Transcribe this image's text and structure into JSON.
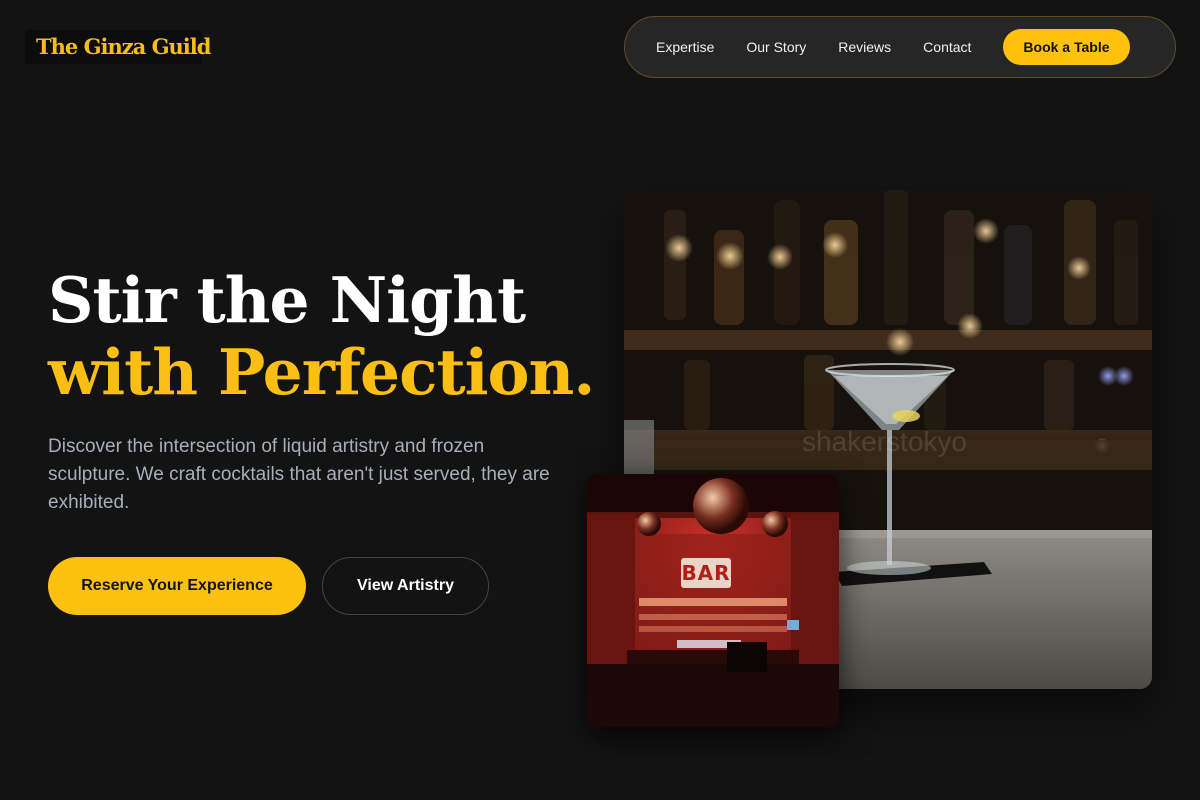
{
  "brand": {
    "name": "The Ginza Guild"
  },
  "nav": {
    "links": [
      "Expertise",
      "Our Story",
      "Reviews",
      "Contact"
    ],
    "cta": "Book a Table"
  },
  "hero": {
    "title_line1": "Stir the Night",
    "title_line2": "with Perfection.",
    "subtitle": "Discover the intersection of liquid artistry and frozen sculpture. We craft cocktails that aren't just served, they are exhibited.",
    "primary_button": "Reserve Your Experience",
    "secondary_button": "View Artistry"
  },
  "images": {
    "main_watermark": "shakerstokyo",
    "bar_sign": "BAR"
  },
  "colors": {
    "accent": "#fcc00e",
    "background": "#131313",
    "nav_bg": "#262626",
    "subtitle": "#a9aebb"
  }
}
